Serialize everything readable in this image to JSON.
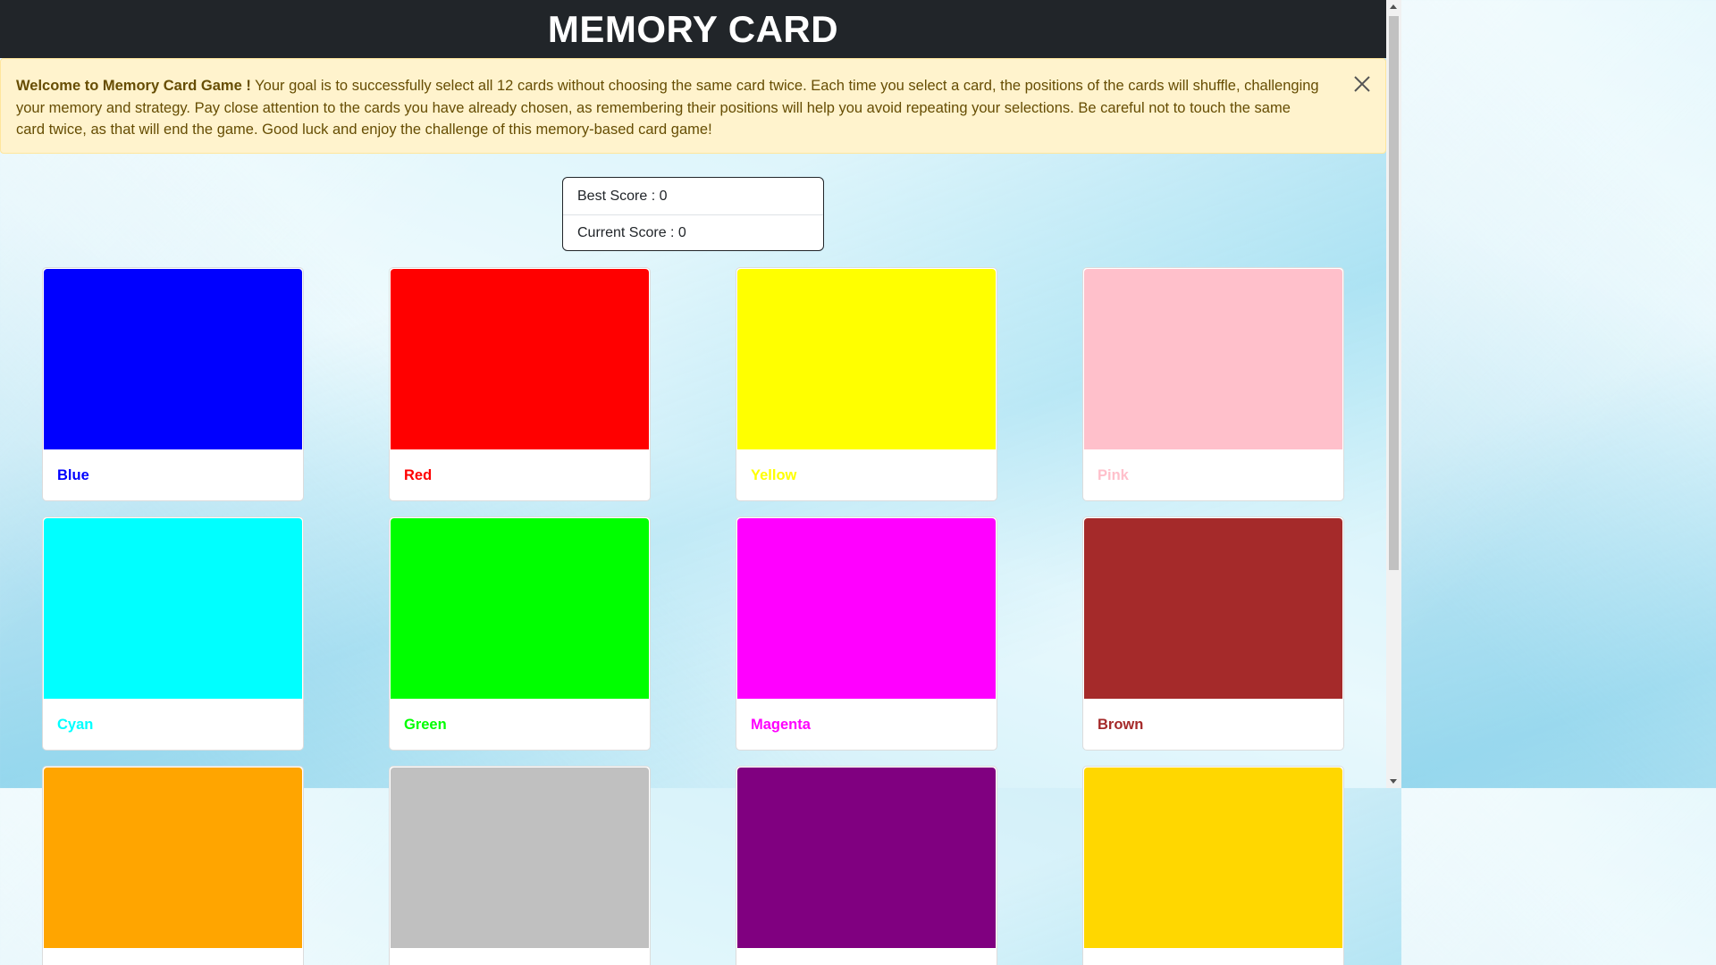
{
  "header": {
    "title": "MEMORY CARD"
  },
  "alert": {
    "title": "Welcome to Memory Card Game !",
    "message": " Your goal is to successfully select all 12 cards without choosing the same card twice. Each time you select a card, the positions of the cards will shuffle, challenging your memory and strategy. Pay close attention to the cards you have already chosen, as remembering their positions will help you avoid repeating your selections. Be careful not to touch the same card twice, as that will end the game. Good luck and enjoy the challenge of this memory-based card game!",
    "close_icon": "close-icon"
  },
  "scores": {
    "best": "Best Score : 0",
    "current": "Current Score : 0"
  },
  "cards": [
    {
      "label": "Blue",
      "color": "#0000ff"
    },
    {
      "label": "Red",
      "color": "#ff0000"
    },
    {
      "label": "Yellow",
      "color": "#ffff00"
    },
    {
      "label": "Pink",
      "color": "#ffc0cb"
    },
    {
      "label": "Cyan",
      "color": "#00ffff"
    },
    {
      "label": "Green",
      "color": "#00ff00"
    },
    {
      "label": "Magenta",
      "color": "#ff00ff"
    },
    {
      "label": "Brown",
      "color": "#a52a2a"
    },
    {
      "label": "",
      "color": "#ffa500"
    },
    {
      "label": "",
      "color": "#c0c0c0"
    },
    {
      "label": "",
      "color": "#800080"
    },
    {
      "label": "",
      "color": "#ffd700"
    }
  ]
}
